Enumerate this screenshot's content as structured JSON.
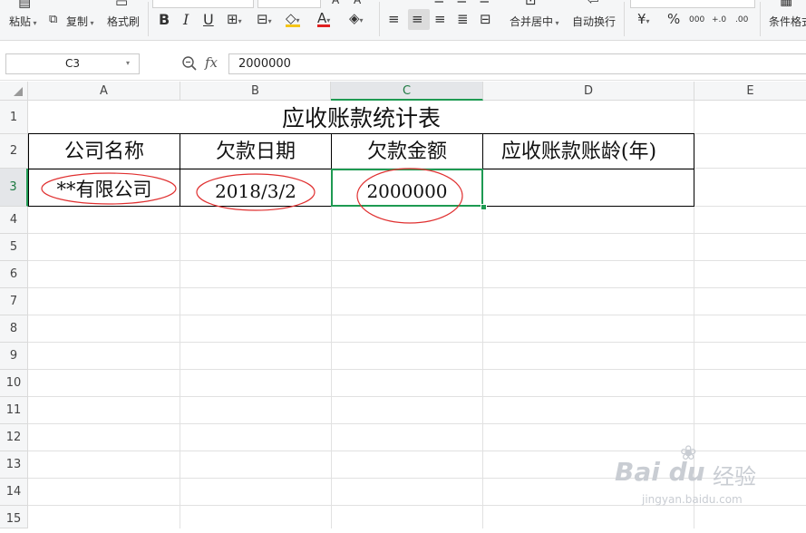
{
  "ribbon": {
    "paste_label": "粘贴",
    "copy_label": "复制",
    "format_painter_label": "格式刷",
    "bold": "B",
    "italic": "I",
    "underline": "U",
    "merge_center_label": "合并居中",
    "wrap_text_label": "自动换行",
    "currency_glyph": "¥",
    "percent_glyph": "%",
    "thousands_glyph": "000",
    "inc_decimal_glyph": "+.0",
    "dec_decimal_glyph": ".00",
    "conditional_format_label": "条件格式",
    "font_color_glyph": "A",
    "font_color": "#e02020",
    "fill_color": "#f5c518"
  },
  "formula_bar": {
    "name_box": "C3",
    "fx_label": "fx",
    "formula": "2000000"
  },
  "sheet": {
    "columns": [
      "A",
      "B",
      "C",
      "D",
      "E"
    ],
    "rows": [
      "1",
      "2",
      "3",
      "4",
      "5",
      "6",
      "7",
      "8",
      "9",
      "10",
      "11",
      "12",
      "13",
      "14",
      "15"
    ],
    "active_cell": "C3",
    "accent": "#1e9a52",
    "annotation_color": "#e03030"
  },
  "table": {
    "title": "应收账款统计表",
    "headers": [
      "公司名称",
      "欠款日期",
      "欠款金额",
      "应收账款账龄(年)"
    ],
    "row": [
      "**有限公司",
      "2018/3/2",
      "2000000",
      ""
    ]
  },
  "watermark": {
    "logo": "Bai du",
    "brand": "经验",
    "url": "jingyan.baidu.com"
  }
}
